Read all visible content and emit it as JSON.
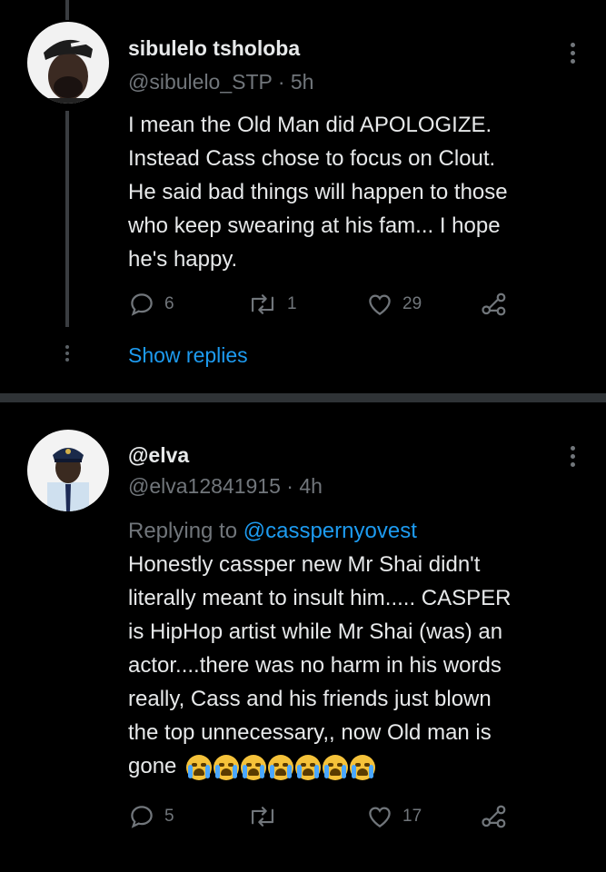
{
  "tweets": [
    {
      "name": "sibulelo tsholoba",
      "handle": "@sibulelo_STP",
      "time": "· 5h",
      "lines": [
        "I mean the Old Man did APOLOGIZE.",
        "Instead Cass chose to focus on Clout.",
        "He said bad things will happen to those",
        "who keep swearing at his fam... I hope",
        "he's happy."
      ],
      "replies": "6",
      "retweets": "1",
      "likes": "29",
      "show_replies": "Show replies"
    },
    {
      "name": "@elva",
      "handle": "@elva12841915",
      "time": "· 4h",
      "replying_label": "Replying to",
      "replying_to": "@casspernyovest",
      "lines": [
        "Honestly cassper new Mr Shai didn't",
        "literally meant to insult him..... CASPER",
        "is HipHop artist while Mr Shai (was) an",
        "actor....there was no harm in his words",
        "really, Cass and his friends just blown",
        "the top unnecessary,, now Old man is",
        "gone"
      ],
      "replies": "5",
      "retweets": "",
      "likes": "17"
    }
  ],
  "colors": {
    "background": "#000000",
    "text": "#e7e9ea",
    "muted": "#71767b",
    "accent": "#1d9bf0"
  },
  "icons": [
    "reply-icon",
    "retweet-icon",
    "like-icon",
    "share-icon",
    "more-icon",
    "crying-emoji"
  ]
}
